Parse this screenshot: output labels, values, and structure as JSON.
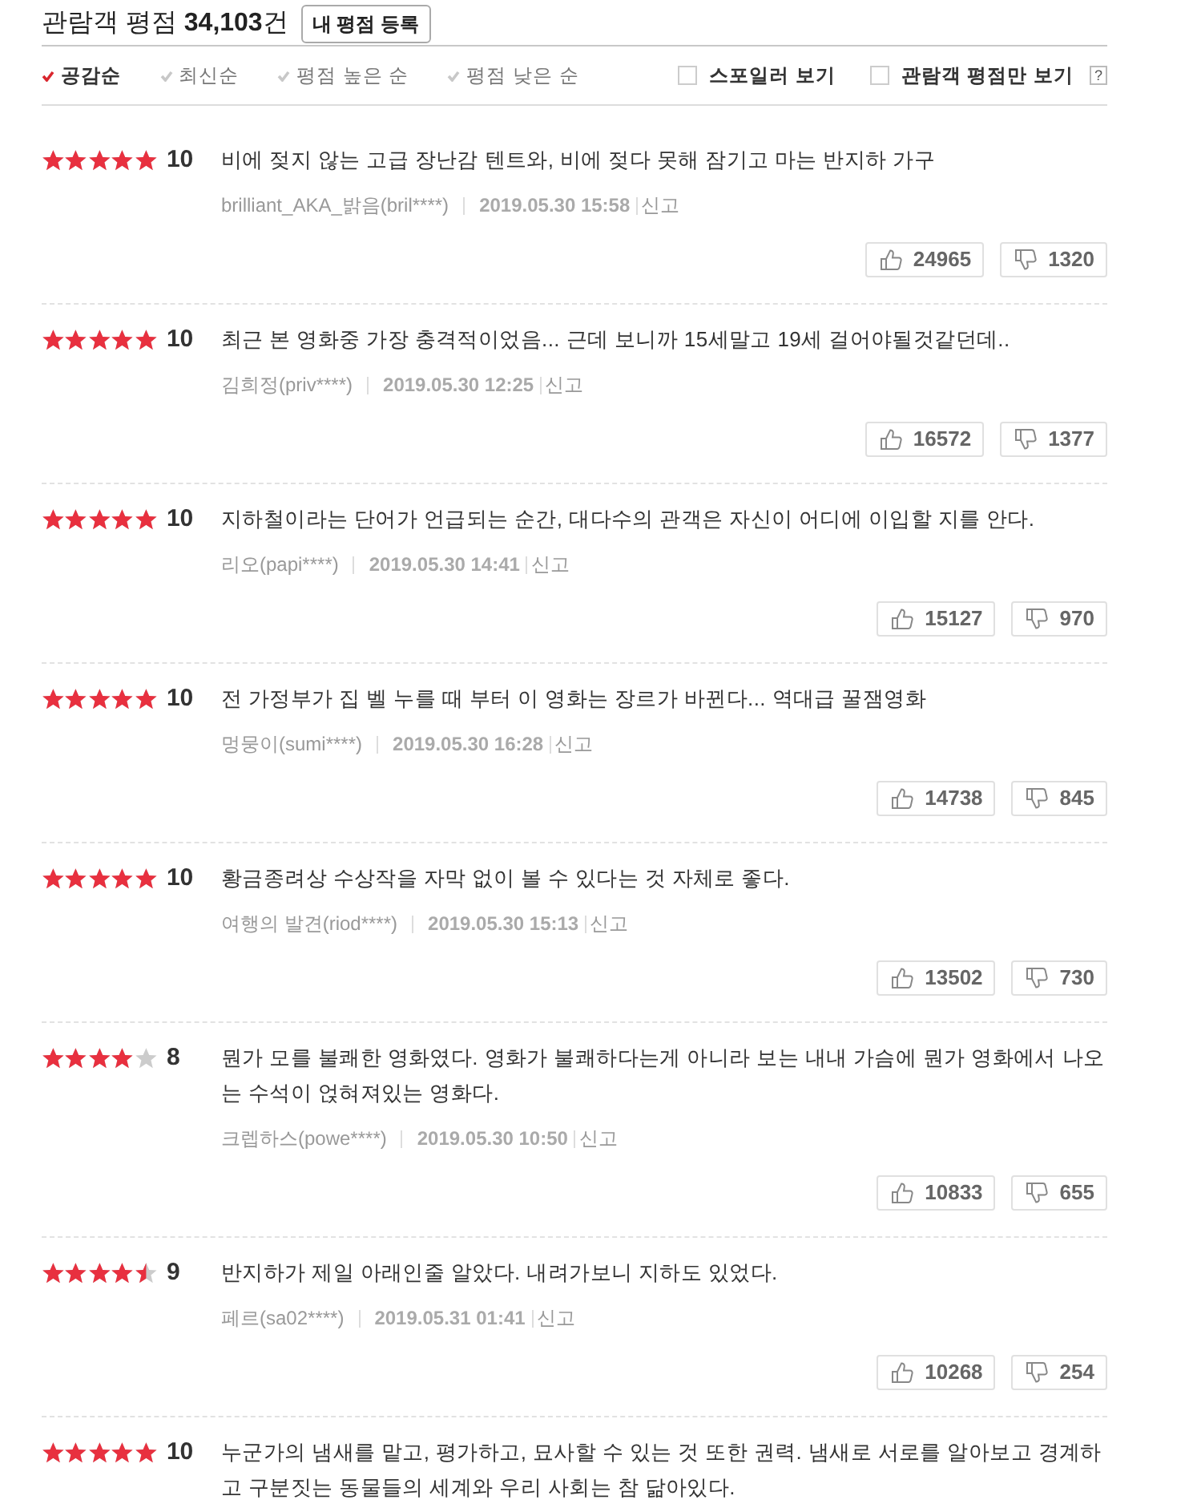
{
  "summary": {
    "text": "관람객 평점 **34,103**건",
    "button": "내 평점 등록"
  },
  "sort_options": [
    {
      "label": "공감순",
      "selected": true
    },
    {
      "label": "최신순",
      "selected": false
    },
    {
      "label": "평점 높은 순",
      "selected": false
    },
    {
      "label": "평점 낮은 순",
      "selected": false
    }
  ],
  "filters": [
    {
      "label": "스포일러 보기",
      "checked": false
    },
    {
      "label": "관람객 평점만 보기",
      "checked": false
    }
  ],
  "help_label": "?",
  "reviews": [
    {
      "stars": 5,
      "score": "10",
      "text": "비에 젖지 않는 고급 장난감 텐트와, 비에 젖다 못해 잠기고 마는 반지하 가구",
      "user": "brilliant_AKA_밝음(bril****)",
      "date": "2019.05.30 15:58",
      "report": "신고",
      "likes": "24965",
      "dislikes": "1320"
    },
    {
      "stars": 5,
      "score": "10",
      "text": "최근 본 영화중 가장 충격적이었음... 근데 보니까 15세말고 19세 걸어야될것같던데..",
      "user": "김희정(priv****)",
      "date": "2019.05.30 12:25",
      "report": "신고",
      "likes": "16572",
      "dislikes": "1377"
    },
    {
      "stars": 5,
      "score": "10",
      "text": "지하철이라는 단어가 언급되는 순간, 대다수의 관객은 자신이 어디에 이입할 지를 안다.",
      "user": "리오(papi****)",
      "date": "2019.05.30 14:41",
      "report": "신고",
      "likes": "15127",
      "dislikes": "970"
    },
    {
      "stars": 5,
      "score": "10",
      "text": "전 가정부가 집 벨 누를 때 부터 이 영화는 장르가 바뀐다... 역대급 꿀잼영화",
      "user": "멍뭉이(sumi****)",
      "date": "2019.05.30 16:28",
      "report": "신고",
      "likes": "14738",
      "dislikes": "845"
    },
    {
      "stars": 5,
      "score": "10",
      "text": "황금종려상 수상작을 자막 없이 볼 수 있다는 것 자체로 좋다.",
      "user": "여행의 발견(riod****)",
      "date": "2019.05.30 15:13",
      "report": "신고",
      "likes": "13502",
      "dislikes": "730"
    },
    {
      "stars": 4,
      "score": "8",
      "text": "뭔가 모를 불쾌한 영화였다. 영화가 불쾌하다는게 아니라 보는 내내 가슴에 뭔가 영화에서 나오는 수석이 얹혀져있는 영화다.",
      "user": "크렙하스(powe****)",
      "date": "2019.05.30 10:50",
      "report": "신고",
      "likes": "10833",
      "dislikes": "655"
    },
    {
      "stars": 4.5,
      "score": "9",
      "text": "반지하가 제일 아래인줄 알았다. 내려가보니 지하도 있었다.",
      "user": "페르(sa02****)",
      "date": "2019.05.31 01:41",
      "report": "신고",
      "likes": "10268",
      "dislikes": "254"
    },
    {
      "stars": 5,
      "score": "10",
      "text": "누군가의 냄새를 맡고, 평가하고, 묘사할 수 있는 것 또한 권력. 냄새로 서로를 알아보고 경계하고 구분짓는 동물들의 세계와 우리 사회는 참 닮아있다."
    }
  ]
}
